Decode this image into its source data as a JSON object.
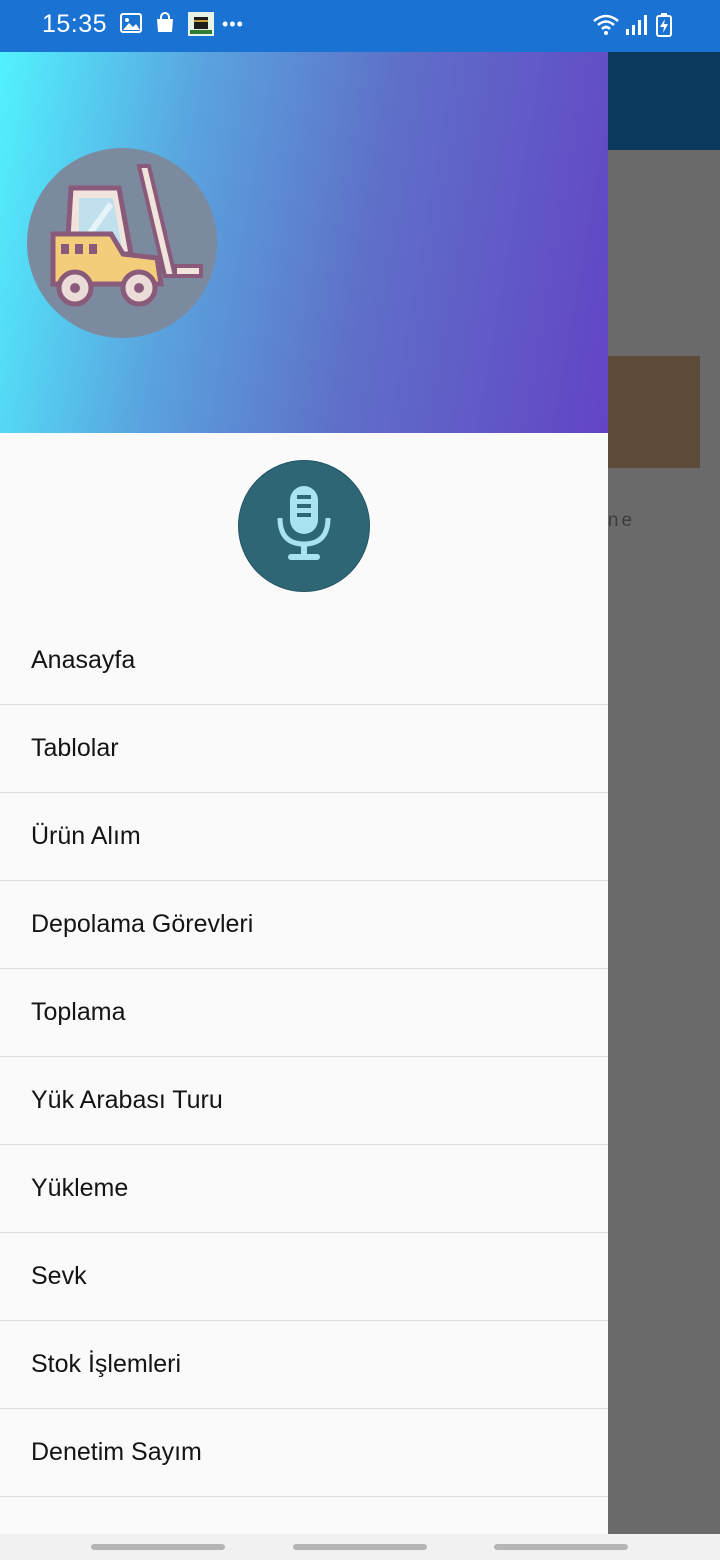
{
  "status_bar": {
    "time": "15:35",
    "more_label": "•••",
    "icons_left": [
      "gallery-icon",
      "shopping-bag-icon",
      "app-badge-icon"
    ],
    "icons_right": [
      "wifi-icon",
      "signal-icon",
      "battery-charging-icon"
    ]
  },
  "background": {
    "partial_text": "s done",
    "toolbar_color": "#0c3a5f"
  },
  "drawer": {
    "header": {
      "gradient": [
        "#52f2ff",
        "#5f6fc8",
        "#6344c6"
      ],
      "avatar_icon": "forklift-icon"
    },
    "mic_button": {
      "icon": "microphone-icon",
      "color": "#2e6675"
    },
    "menu_items": [
      {
        "label": "Anasayfa"
      },
      {
        "label": "Tablolar"
      },
      {
        "label": "Ürün Alım"
      },
      {
        "label": "Depolama Görevleri"
      },
      {
        "label": "Toplama"
      },
      {
        "label": "Yük Arabası Turu"
      },
      {
        "label": "Yükleme"
      },
      {
        "label": "Sevk"
      },
      {
        "label": "Stok İşlemleri"
      },
      {
        "label": "Denetim Sayım"
      }
    ]
  }
}
